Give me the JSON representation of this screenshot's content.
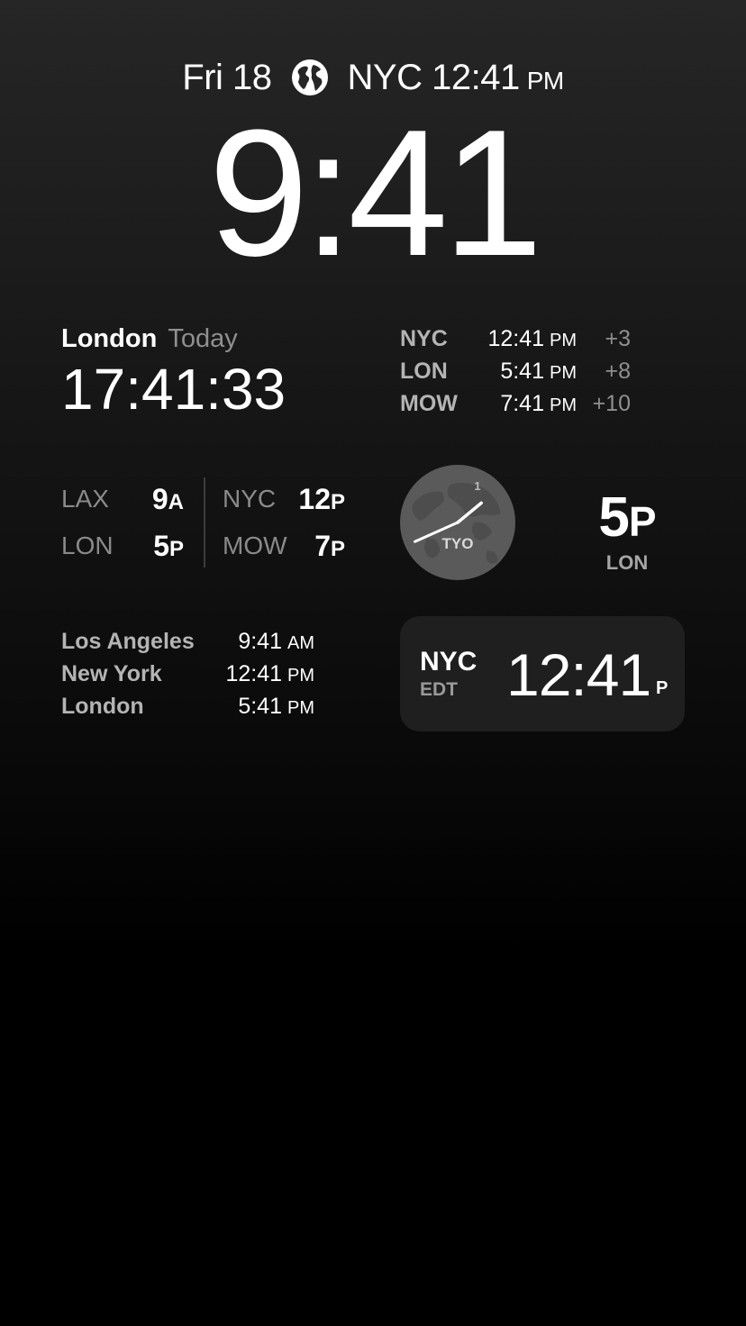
{
  "header": {
    "date": "Fri 18",
    "globe_icon": "globe-icon",
    "city_time": "NYC 12:41",
    "ampm": "PM"
  },
  "clock": {
    "time": "9:41"
  },
  "london_widget": {
    "city": "London",
    "day": "Today",
    "time": "17:41:33"
  },
  "offsets_widget": {
    "rows": [
      {
        "code": "NYC",
        "time": "12:41",
        "ampm": "PM",
        "delta": "+3"
      },
      {
        "code": "LON",
        "time": "5:41",
        "ampm": "PM",
        "delta": "+8"
      },
      {
        "code": "MOW",
        "time": "7:41",
        "ampm": "PM",
        "delta": "+10"
      }
    ]
  },
  "grid_widget": {
    "cells": [
      {
        "code": "LAX",
        "value": "9",
        "suffix": "A"
      },
      {
        "code": "LON",
        "value": "5",
        "suffix": "P"
      },
      {
        "code": "NYC",
        "value": "12",
        "suffix": "P"
      },
      {
        "code": "MOW",
        "value": "7",
        "suffix": "P"
      }
    ]
  },
  "analog_widget": {
    "label": "TYO",
    "marker": "1",
    "hour": 1,
    "minute": 41
  },
  "city_widget": {
    "value": "5",
    "suffix": "P",
    "label": "LON"
  },
  "world_widget": {
    "rows": [
      {
        "city": "Los Angeles",
        "time": "9:41",
        "ampm": "AM"
      },
      {
        "city": "New York",
        "time": "12:41",
        "ampm": "PM"
      },
      {
        "city": "London",
        "time": "5:41",
        "ampm": "PM"
      }
    ]
  },
  "card_widget": {
    "code": "NYC",
    "tz": "EDT",
    "time": "12:41",
    "suffix": "P"
  }
}
